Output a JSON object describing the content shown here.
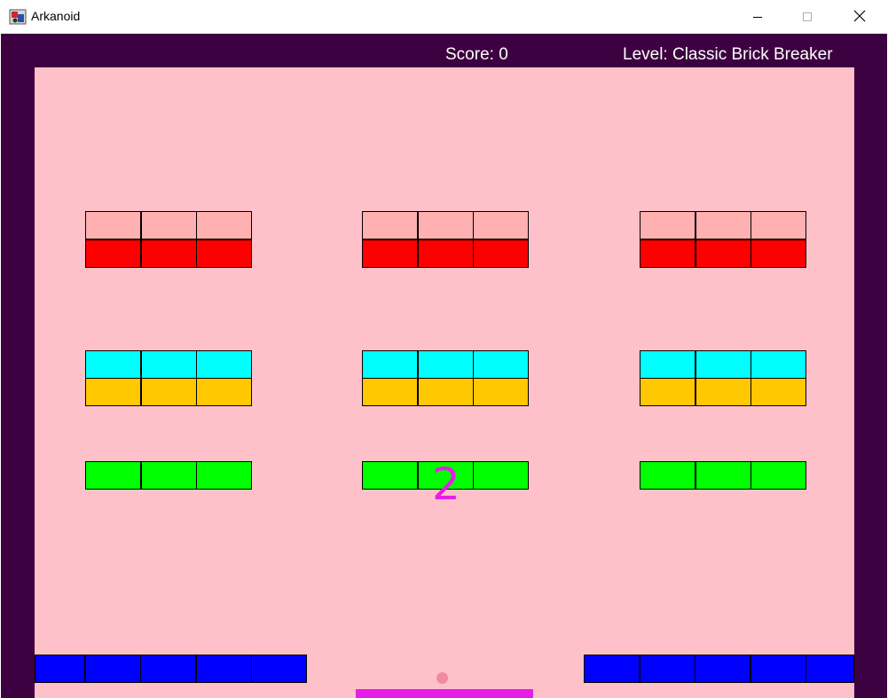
{
  "window": {
    "title": "Arkanoid",
    "icons": {
      "app": "arkanoid-app-icon",
      "minimize": "minimize-icon",
      "maximize": "maximize-icon",
      "close": "close-icon"
    }
  },
  "hud": {
    "score": "Score: 0",
    "level": "Level: Classic Brick Breaker"
  },
  "colors": {
    "frame": "#3d0040",
    "playfield": "#ffc1c9",
    "hud_text": "#ffffff",
    "countdown": "#e61de6",
    "ball": "#f28aa1",
    "paddle": "#e61de6"
  },
  "countdown": "2",
  "brick_rows": [
    {
      "row": 1,
      "color": "#ffb0b0"
    },
    {
      "row": 2,
      "color": "#ff0000"
    },
    {
      "row": 3,
      "color": "#00ffff"
    },
    {
      "row": 4,
      "color": "#ffc800"
    },
    {
      "row": 5,
      "color": "#00ff00"
    },
    {
      "row": 6,
      "color": "#0000ff"
    }
  ]
}
